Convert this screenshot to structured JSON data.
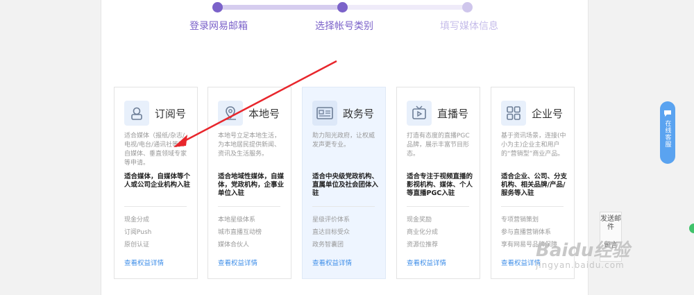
{
  "steps": {
    "step1": "登录网易邮箱",
    "step2": "选择帐号类别",
    "step3": "填写媒体信息"
  },
  "cards": [
    {
      "title": "订阅号",
      "icon": "subscriber-icon",
      "desc": "适合媒体（报纸/杂志/电视/电台/通讯社等）、自媒体、垂直领域专家等申请。",
      "target": "适合媒体，自媒体等个人或公司企业机构入驻",
      "benefits": [
        "现金分成",
        "订阅Push",
        "原创认证"
      ],
      "link": "查看权益详情"
    },
    {
      "title": "本地号",
      "icon": "location-icon",
      "desc": "本地号立足本地生活，为本地居民提供新闻、资讯及生活服务。",
      "target": "适合地域性媒体，自媒体，党政机构，企事业单位入驻",
      "benefits": [
        "本地星级体系",
        "城市直播互动榜",
        "媒体合伙人"
      ],
      "link": "查看权益详情"
    },
    {
      "title": "政务号",
      "icon": "government-icon",
      "desc": "助力阳光政府，让权威发声更专业。",
      "target": "适合中央级党政机构、直属单位及社会团体入驻",
      "benefits": [
        "星级评价体系",
        "直达目标受众",
        "政务智囊团"
      ],
      "link": "查看权益详情"
    },
    {
      "title": "直播号",
      "icon": "tv-icon",
      "desc": "打造有态度的直播PGC品牌，展示丰富节目形态。",
      "target": "适合专注于视频直播的影视机构、媒体、个人等直播PGC入驻",
      "benefits": [
        "现金奖励",
        "商业化分成",
        "资源位推荐"
      ],
      "link": "查看权益详情"
    },
    {
      "title": "企业号",
      "icon": "grid-icon",
      "desc": "基于资讯场景，连接(中小为主)企业主和用户的“营销型”商业产品。",
      "target": "适合企业、公司、分支机构、相关品牌/产品/服务等入驻",
      "benefits": [
        "专项营销策划",
        "参与直播营销体系",
        "享有网易号品牌保障"
      ],
      "link": "查看权益详情"
    }
  ],
  "side": {
    "customer_service": "在线客服",
    "send_mail": "发送邮件",
    "extra": "留言"
  },
  "watermark": {
    "main": "Baidu经验",
    "sub": "jingyan.baidu.com"
  },
  "colors": {
    "accent": "#7b62c9",
    "link": "#3e8ee8",
    "annotation_arrow": "#e8262c"
  }
}
